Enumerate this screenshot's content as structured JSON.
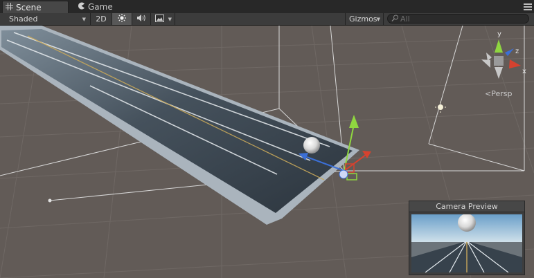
{
  "tabs": [
    {
      "label": "Scene",
      "icon": "scene-grid-icon",
      "active": true
    },
    {
      "label": "Game",
      "icon": "game-pacman-icon",
      "active": false
    }
  ],
  "toolbar": {
    "draw_mode": "Shaded",
    "mode_2d": "2D",
    "lighting_icon": "sun-icon",
    "audio_icon": "speaker-icon",
    "effects_icon": "image-icon",
    "gizmos_label": "Gizmos",
    "search_placeholder": "All"
  },
  "scene": {
    "axes": {
      "y": "y",
      "z": "z",
      "x": "x"
    },
    "projection_label": "Persp",
    "colors": {
      "background": "#625b57",
      "road": "#3e4954",
      "road_edge": "#aab4bd",
      "y_axis": "#8fd640",
      "x_axis": "#d6422f",
      "z_axis": "#3b6fd6"
    }
  },
  "camera_preview": {
    "title": "Camera Preview"
  }
}
